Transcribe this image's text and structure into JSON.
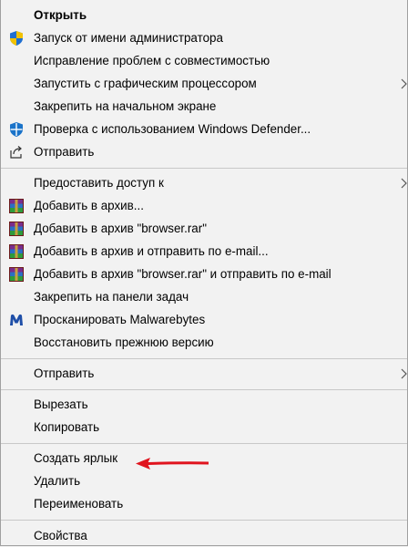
{
  "menu": {
    "items": [
      {
        "label": "Открыть",
        "icon": "none",
        "bold": true
      },
      {
        "label": "Запуск от имени администратора",
        "icon": "uac-shield-icon"
      },
      {
        "label": "Исправление проблем с совместимостью",
        "icon": "none"
      },
      {
        "label": "Запустить с графическим процессором",
        "icon": "none",
        "submenu": true
      },
      {
        "label": "Закрепить на начальном экране",
        "icon": "none"
      },
      {
        "label": "Проверка с использованием Windows Defender...",
        "icon": "windows-defender-icon"
      },
      {
        "label": "Отправить",
        "icon": "share-icon"
      },
      {
        "label": "Предоставить доступ к",
        "icon": "none",
        "submenu": true
      },
      {
        "label": "Добавить в архив...",
        "icon": "winrar-icon"
      },
      {
        "label": "Добавить в архив \"browser.rar\"",
        "icon": "winrar-icon"
      },
      {
        "label": "Добавить в архив и отправить по e-mail...",
        "icon": "winrar-icon"
      },
      {
        "label": "Добавить в архив \"browser.rar\" и отправить по e-mail",
        "icon": "winrar-icon"
      },
      {
        "label": "Закрепить на панели задач",
        "icon": "none"
      },
      {
        "label": "Просканировать Malwarebytes",
        "icon": "malwarebytes-icon"
      },
      {
        "label": "Восстановить прежнюю версию",
        "icon": "none"
      },
      {
        "label": "Отправить",
        "icon": "none",
        "submenu": true
      },
      {
        "label": "Вырезать",
        "icon": "none"
      },
      {
        "label": "Копировать",
        "icon": "none"
      },
      {
        "label": "Создать ярлык",
        "icon": "none",
        "highlighted_by_annotation": true
      },
      {
        "label": "Удалить",
        "icon": "none"
      },
      {
        "label": "Переименовать",
        "icon": "none"
      },
      {
        "label": "Свойства",
        "icon": "none"
      }
    ]
  },
  "colors": {
    "menu_bg": "#f2f2f2",
    "separator": "#c8c8c8",
    "annotation_arrow": "#e0141e",
    "shield_blue": "#1f6fd1",
    "shield_yellow": "#f2c200",
    "defender_blue": "#1a73c9",
    "malwarebytes_blue": "#1f4fa8"
  }
}
